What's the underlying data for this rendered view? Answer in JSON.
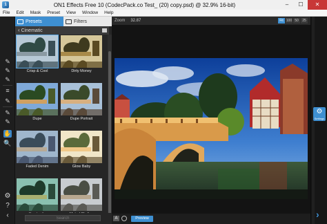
{
  "window": {
    "title": "ON1 Effects Free 10 (CodecPack.co Test_ (20) copy.psd) @ 32.9% 16-bit)",
    "app_icon": "on1-app-icon",
    "controls": {
      "minimize": "–",
      "maximize": "☐",
      "close": "✕"
    }
  },
  "menu": [
    "File",
    "Edit",
    "Mask",
    "Preset",
    "View",
    "Window",
    "Help"
  ],
  "tools": [
    {
      "name": "brush-icon",
      "glyph": "✎"
    },
    {
      "name": "brush-plus-icon",
      "glyph": "✎"
    },
    {
      "name": "line-mask-icon",
      "glyph": "✎"
    },
    {
      "name": "smart-brush-icon",
      "glyph": "≡"
    },
    {
      "name": "chisel-icon",
      "glyph": "✎"
    },
    {
      "name": "retouch-icon",
      "glyph": "✎"
    },
    {
      "name": "perfect-eraser-icon",
      "glyph": "✎"
    },
    {
      "name": "hand-icon",
      "glyph": "✋"
    },
    {
      "name": "zoom-icon",
      "glyph": "🔍"
    }
  ],
  "panel": {
    "tabs": [
      {
        "label": "Presets",
        "active": true
      },
      {
        "label": "Filters",
        "active": false
      }
    ],
    "category": "Cinematic",
    "presets": [
      {
        "label": "Crisp & Cool",
        "style": "cool",
        "selected": true
      },
      {
        "label": "Dirty Money",
        "style": "money",
        "selected": false
      },
      {
        "label": "Dupe",
        "style": "dupe",
        "selected": false
      },
      {
        "label": "Dupe Portrait",
        "style": "portrait",
        "selected": false
      },
      {
        "label": "Faded Denim",
        "style": "denim",
        "selected": false
      },
      {
        "label": "Glow Baby",
        "style": "glow",
        "selected": false
      },
      {
        "label": "Kryptonite",
        "style": "kryptonite",
        "selected": false
      },
      {
        "label": "Muted Skyline",
        "style": "muted",
        "selected": false
      }
    ],
    "search_placeholder": "Search"
  },
  "zoom": {
    "label": "Zoom",
    "value": "32.87",
    "buttons": [
      {
        "label": "Fit",
        "active": true
      },
      {
        "label": "100",
        "active": false
      },
      {
        "label": "50",
        "active": false
      },
      {
        "label": "25",
        "active": false
      }
    ]
  },
  "bottom_bar": {
    "compare_label": "A",
    "preview_label": "Preview"
  },
  "right_panel": {
    "settings_label": "Settings",
    "expand_icon": "chevron-right-icon"
  },
  "colors": {
    "accent": "#3e8fd1",
    "panel_bg": "#262626",
    "preview_bg": "#131313"
  }
}
